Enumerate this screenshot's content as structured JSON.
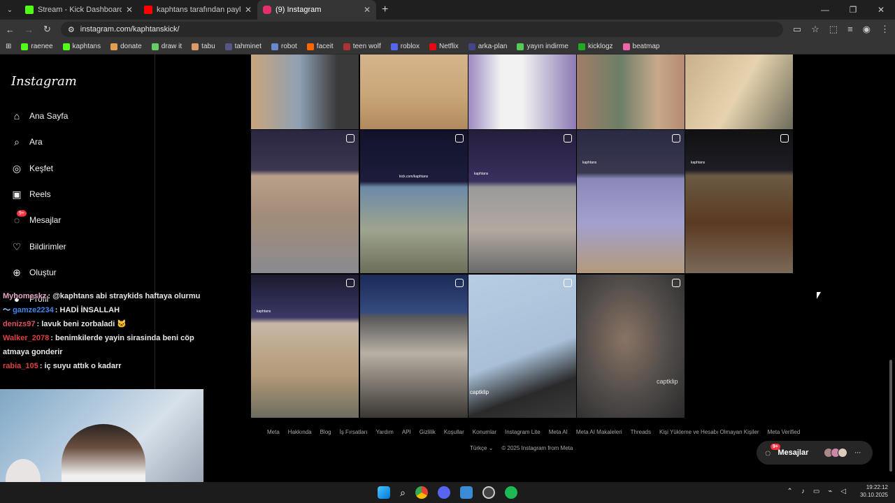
{
  "tabs": [
    {
      "title": "Stream - Kick Dashboard",
      "color": "#53fc18"
    },
    {
      "title": "kaphtans tarafından paylaşılan ...",
      "color": "#ff0000"
    },
    {
      "title": "(9) Instagram",
      "color": "#e1306c"
    }
  ],
  "url": "instagram.com/kaphtanskick/",
  "bookmarks": [
    "raenee",
    "kaphtans",
    "donate",
    "draw it",
    "tabu",
    "tahminet",
    "robot",
    "faceit",
    "teen wolf",
    "roblox",
    "Netflix",
    "arka-plan",
    "yayın indirme",
    "kicklogz",
    "beatmap"
  ],
  "sidebar": {
    "logo": "Instagram",
    "items": [
      {
        "label": "Ana Sayfa",
        "icon": "home-icon",
        "glyph": "⌂"
      },
      {
        "label": "Ara",
        "icon": "search-icon",
        "glyph": "⌕"
      },
      {
        "label": "Keşfet",
        "icon": "compass-icon",
        "glyph": "◎"
      },
      {
        "label": "Reels",
        "icon": "reels-icon",
        "glyph": "▣"
      },
      {
        "label": "Mesajlar",
        "icon": "messenger-icon",
        "glyph": "◌",
        "badge": "9+"
      },
      {
        "label": "Bildirimler",
        "icon": "heart-icon",
        "glyph": "♡"
      },
      {
        "label": "Oluştur",
        "icon": "plus-icon",
        "glyph": "⊕"
      },
      {
        "label": "Profil",
        "icon": "profile-icon",
        "glyph": "●"
      }
    ]
  },
  "chat": [
    {
      "user": "Myhomeskz",
      "color": "#e7a8c8",
      "msg": ": @kaphtans abi straykids haftaya olurmu"
    },
    {
      "user": "gamze2234",
      "color": "#3f86f0",
      "msg": ": HADİ İNSALLAH"
    },
    {
      "user": "denizs97",
      "color": "#e05060",
      "msg": ": lavuk beni zorbaladi 🐱"
    },
    {
      "user": "Walker_2078",
      "color": "#e04040",
      "msg": ": benimkilerde yayin sirasinda beni cöp atmaya gonderir"
    },
    {
      "user": "rabia_105",
      "color": "#e04040",
      "msg": ": iç suyu attık o kadarr"
    }
  ],
  "grid_labels": {
    "kick_tag": "kaphtans",
    "kick_url": "kick.com/kaphtans",
    "captklip": "captklip"
  },
  "footer": [
    "Meta",
    "Hakkında",
    "Blog",
    "İş Fırsatları",
    "Yardım",
    "API",
    "Gizlilik",
    "Koşullar",
    "Konumlar",
    "Instagram Lite",
    "Meta AI",
    "Meta AI Makaleleri",
    "Threads",
    "Kişi Yükleme ve Hesabı Olmayan Kişiler",
    "Meta Verified"
  ],
  "language": "Türkçe",
  "copyright": "© 2025 Instagram from Meta",
  "messages_button": {
    "label": "Mesajlar",
    "badge": "9+"
  },
  "clock": {
    "time": "19:22:12",
    "date": "30.10.2025"
  }
}
